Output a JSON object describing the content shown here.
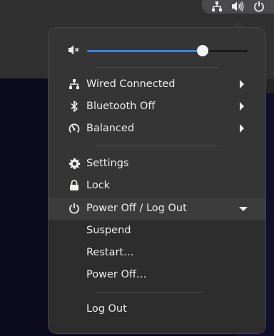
{
  "volume": {
    "level_percent": 72
  },
  "network": {
    "label": "Wired Connected"
  },
  "bluetooth": {
    "label": "Bluetooth Off"
  },
  "power_mode": {
    "label": "Balanced"
  },
  "settings": {
    "label": "Settings"
  },
  "lock": {
    "label": "Lock"
  },
  "power_menu": {
    "label": "Power Off / Log Out",
    "items": [
      "Suspend",
      "Restart…",
      "Power Off…"
    ],
    "logout": "Log Out"
  },
  "colors": {
    "accent": "#3584e4",
    "menu_bg": "#353535",
    "text": "#eeeeec"
  },
  "icons": {
    "tray": [
      "network-wired-icon",
      "speaker-icon",
      "power-icon"
    ],
    "volume": "speaker-muted-icon",
    "network": "network-wired-icon",
    "bluetooth": "bluetooth-icon",
    "power_mode": "gauge-icon",
    "settings": "gear-icon",
    "lock": "lock-icon",
    "power": "power-icon"
  }
}
